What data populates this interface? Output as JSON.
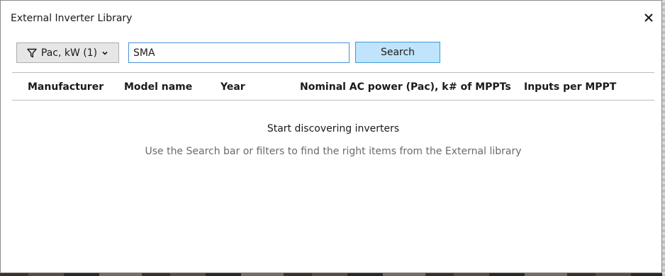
{
  "dialog": {
    "title": "External Inverter Library"
  },
  "filter": {
    "label": "Pac, kW (1)",
    "icon": "funnel-icon",
    "chevron": "chevron-down-icon"
  },
  "search": {
    "value": "SMA",
    "button_label": "Search"
  },
  "table": {
    "columns": [
      "Manufacturer",
      "Model name",
      "Year",
      "Nominal AC power (Pac), k",
      "# of MPPTs",
      "Inputs per MPPT"
    ]
  },
  "empty_state": {
    "title": "Start discovering inverters",
    "subtitle": "Use the Search bar or filters to find the right items from the External library"
  },
  "colors": {
    "search_button_bg": "#bfe4fb",
    "search_button_border": "#3e9bd8",
    "input_border": "#4a90d9"
  }
}
